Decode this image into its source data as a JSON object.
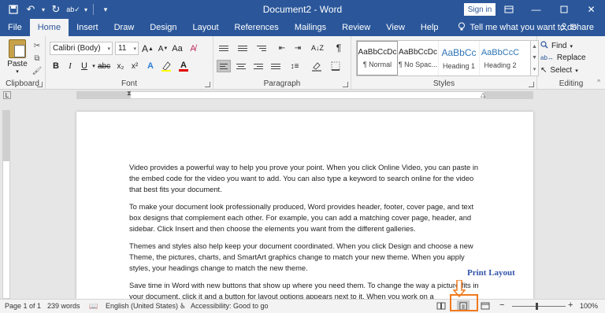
{
  "title_bar": {
    "document_title": "Document2 - Word",
    "sign_in": "Sign in",
    "qat_icons": [
      "save-icon",
      "undo-icon",
      "redo-icon",
      "spelling-icon",
      "customize-icon"
    ]
  },
  "tabs": [
    {
      "label": "File"
    },
    {
      "label": "Home"
    },
    {
      "label": "Insert"
    },
    {
      "label": "Draw"
    },
    {
      "label": "Design"
    },
    {
      "label": "Layout"
    },
    {
      "label": "References"
    },
    {
      "label": "Mailings"
    },
    {
      "label": "Review"
    },
    {
      "label": "View"
    },
    {
      "label": "Help"
    }
  ],
  "tell_me": "Tell me what you want to do",
  "share": "Share",
  "ribbon": {
    "clipboard": {
      "label": "Clipboard",
      "paste": "Paste"
    },
    "font": {
      "label": "Font",
      "font_name": "Calibri (Body)",
      "font_size": "11"
    },
    "paragraph": {
      "label": "Paragraph"
    },
    "styles": {
      "label": "Styles",
      "items": [
        {
          "sample": "AaBbCcDc",
          "name": "¶ Normal"
        },
        {
          "sample": "AaBbCcDc",
          "name": "¶ No Spac..."
        },
        {
          "sample": "AaBbCc",
          "name": "Heading 1"
        },
        {
          "sample": "AaBbCcC",
          "name": "Heading 2"
        }
      ]
    },
    "editing": {
      "label": "Editing",
      "find": "Find",
      "replace": "Replace",
      "select": "Select"
    }
  },
  "document": {
    "paragraphs": [
      "Video provides a powerful way to help you prove your point. When you click Online Video, you can paste in the embed code for the video you want to add. You can also type a keyword to search online for the video that best fits your document.",
      "To make your document look professionally produced, Word provides header, footer, cover page, and text box designs that complement each other. For example, you can add a matching cover page, header, and sidebar. Click Insert and then choose the elements you want from the different galleries.",
      "Themes and styles also help keep your document coordinated. When you click Design and choose a new Theme, the pictures, charts, and SmartArt graphics change to match your new theme. When you apply styles, your headings change to match the new theme.",
      "Save time in Word with new buttons that show up where you need them. To change the way a picture fits in your document, click it and a button for layout options appears next to it. When you work on a"
    ]
  },
  "callout": "Print Layout",
  "status_bar": {
    "page": "Page 1 of 1",
    "words": "239 words",
    "language": "English (United States)",
    "accessibility": "Accessibility: Good to go",
    "zoom": "100%",
    "minus": "−",
    "plus": "+"
  },
  "colors": {
    "accent": "#2b579a",
    "highlight": "#f07a1e",
    "callout": "#3355aa"
  }
}
